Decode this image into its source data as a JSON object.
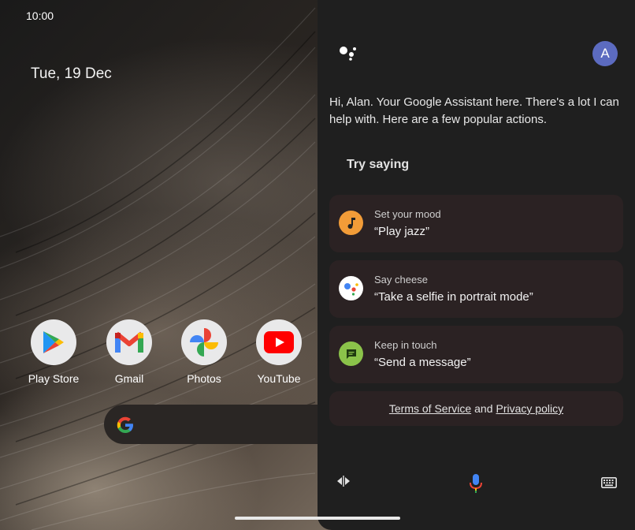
{
  "status_bar": {
    "time": "10:00"
  },
  "home": {
    "date": "Tue, 19 Dec",
    "apps": [
      {
        "label": "Play Store"
      },
      {
        "label": "Gmail"
      },
      {
        "label": "Photos"
      },
      {
        "label": "YouTube"
      }
    ]
  },
  "assistant": {
    "avatar_letter": "A",
    "greeting": "Hi, Alan. Your Google Assistant here. There's a lot I can help with. Here are a few popular actions.",
    "try_heading": "Try saying",
    "suggestions": [
      {
        "title": "Set your mood",
        "phrase": "“Play jazz”",
        "icon": "music-note-icon",
        "color": "#f29c38"
      },
      {
        "title": "Say cheese",
        "phrase": "“Take a selfie in portrait mode”",
        "icon": "assistant-icon",
        "color": "#ffffff"
      },
      {
        "title": "Keep in touch",
        "phrase": "“Send a message”",
        "icon": "message-icon",
        "color": "#8bc34a"
      }
    ],
    "terms_link": "Terms of Service",
    "terms_and": "and",
    "privacy_link": "Privacy policy"
  },
  "colors": {
    "panel_bg": "#1f1f1f",
    "card_bg": "#2b2223",
    "avatar": "#5c6bc0"
  }
}
